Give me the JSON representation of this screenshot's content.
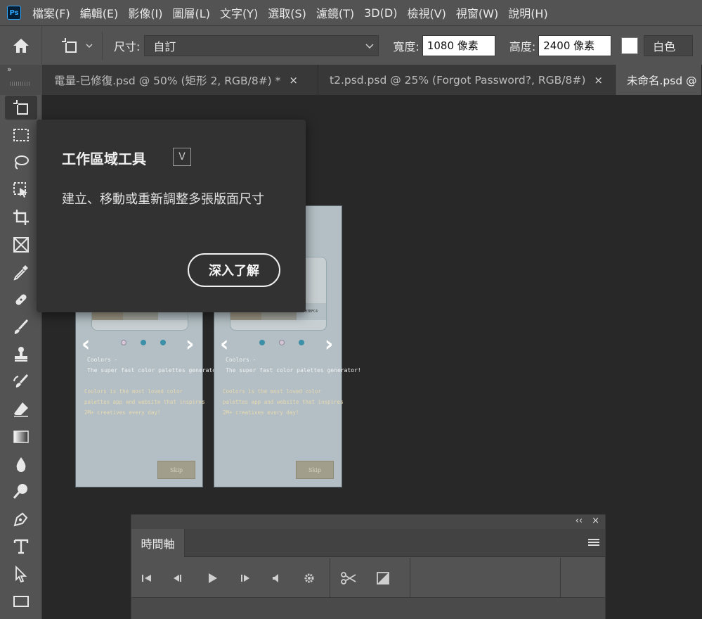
{
  "app": {
    "logo": "Ps",
    "menu": [
      "檔案(F)",
      "編輯(E)",
      "影像(I)",
      "圖層(L)",
      "文字(Y)",
      "選取(S)",
      "濾鏡(T)",
      "3D(D)",
      "檢視(V)",
      "視窗(W)",
      "說明(H)"
    ]
  },
  "options": {
    "size_label": "尺寸:",
    "size_value": "自訂",
    "width_label": "寬度:",
    "width_value": "1080 像素",
    "height_label": "高度:",
    "height_value": "2400 像素",
    "color_select": "白色"
  },
  "tabs": [
    {
      "label": "電量-已修復.psd @ 50% (矩形 2, RGB/8#) *",
      "close": "×"
    },
    {
      "label": "t2.psd.psd @ 25% (Forgot Password?, RGB/8#)",
      "close": "×"
    },
    {
      "label": "未命名.psd @",
      "close": ""
    }
  ],
  "panel_collapse": "»",
  "tools": [
    "artboard-tool",
    "marquee-tool",
    "lasso-tool",
    "object-select-tool",
    "crop-tool",
    "frame-tool",
    "eyedropper-tool",
    "healing-brush-tool",
    "brush-tool",
    "clone-stamp-tool",
    "history-brush-tool",
    "eraser-tool",
    "gradient-tool",
    "blur-tool",
    "dodge-tool",
    "pen-tool",
    "type-tool",
    "path-select-tool",
    "rectangle-tool"
  ],
  "tooltip": {
    "title": "工作區域工具",
    "shortcut": "V",
    "description": "建立、移動或重新調整多張版面尺寸",
    "button": "深入了解"
  },
  "artboards": [
    {
      "swatches": [
        "9C9583",
        "A1A49B",
        "B3BFC4"
      ],
      "app_name": "Coolors -",
      "tagline": "The super fast color palettes generator!",
      "desc": "Coolors is the most loved color\npalettes app and website that inspires\n2M+ creatives every day!",
      "skip": "Skip"
    },
    {
      "swatches": [
        "9C9583",
        "A1A49B",
        "B3BFC4"
      ],
      "app_name": "Coolors -",
      "tagline": "The super fast color palettes generator!",
      "desc": "Coolors is the most loved color\npalettes app and website that inspires\n2M+ creatives every day!",
      "skip": "Skip"
    }
  ],
  "timeline": {
    "title": "時間軸",
    "collapse": "‹‹",
    "close": "×"
  },
  "colors": {
    "accent": "#31a8ff",
    "artboard_bg": "#b3bfc4",
    "dot_teal": "#3c8fa6",
    "dot_pink": "#d4c4d4"
  }
}
